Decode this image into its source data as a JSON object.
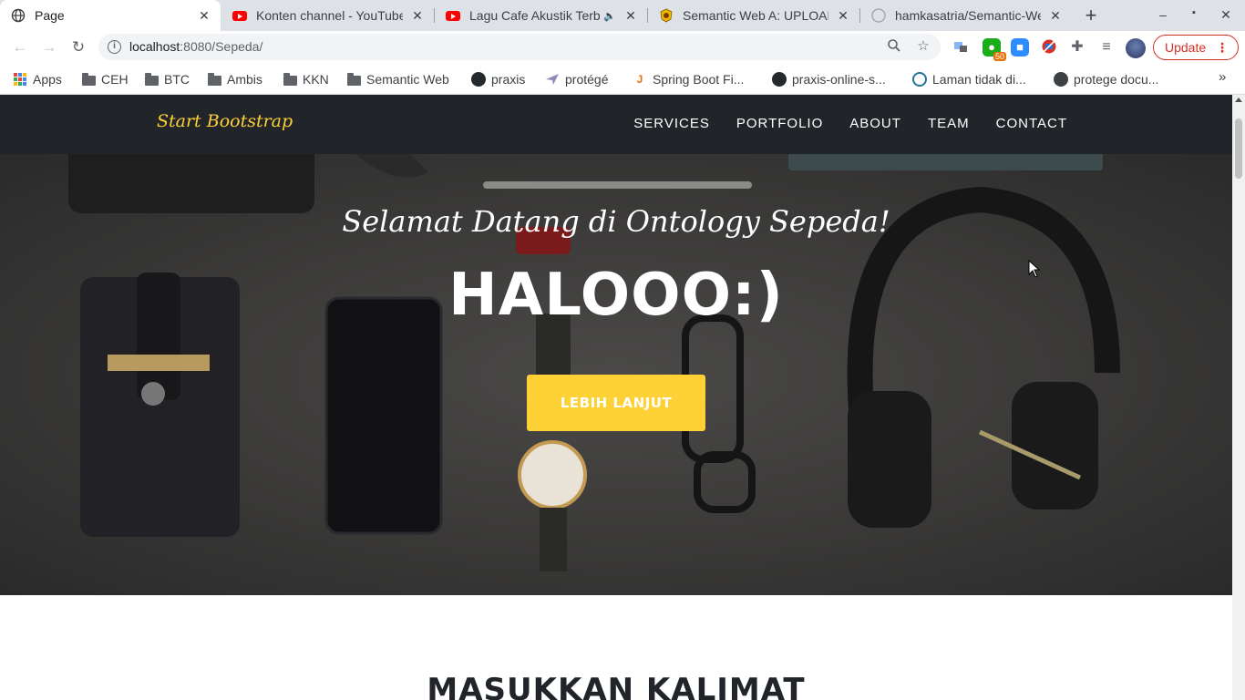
{
  "browser": {
    "tabs": [
      {
        "title": "Page",
        "favicon": "globe-icon",
        "active": true
      },
      {
        "title": "Konten channel - YouTube",
        "favicon": "youtube-icon",
        "active": false
      },
      {
        "title": "Lagu Cafe Akustik Terbaru",
        "favicon": "youtube-icon",
        "active": false,
        "audio": true
      },
      {
        "title": "Semantic Web A: UPLOAD",
        "favicon": "university-logo-icon",
        "active": false
      },
      {
        "title": "hamkasatria/Semantic-Web",
        "favicon": "github-icon",
        "active": false
      }
    ],
    "url_host": "localhost",
    "url_rest": ":8080/Sepeda/",
    "update_label": "Update",
    "extension_badge": "50",
    "bookmarks": [
      {
        "label": "Apps",
        "icon": "apps-grid-icon"
      },
      {
        "label": "CEH",
        "icon": "folder-icon"
      },
      {
        "label": "BTC",
        "icon": "folder-icon"
      },
      {
        "label": "Ambis",
        "icon": "folder-icon"
      },
      {
        "label": "KKN",
        "icon": "folder-icon"
      },
      {
        "label": "Semantic Web",
        "icon": "folder-icon"
      },
      {
        "label": "praxis",
        "icon": "github-icon"
      },
      {
        "label": "protégé",
        "icon": "protege-icon"
      },
      {
        "label": "Spring Boot Fi...",
        "icon": "javatpoint-icon"
      },
      {
        "label": "praxis-online-s...",
        "icon": "github-icon"
      },
      {
        "label": "Laman tidak di...",
        "icon": "wordpress-icon"
      },
      {
        "label": "protege docu...",
        "icon": "globe-icon"
      }
    ]
  },
  "page": {
    "brand": "Start Bootstrap",
    "nav": [
      "Services",
      "Portfolio",
      "About",
      "Team",
      "Contact"
    ],
    "hero_subheading": "Selamat Datang di Ontology Sepeda!",
    "hero_heading": "HALOOO:)",
    "hero_button": "LEBIH LANJUT",
    "section_title": "MASUKKAN KALIMAT"
  },
  "colors": {
    "accent": "#fed136",
    "navbar": "#212529",
    "update_red": "#d93025"
  }
}
